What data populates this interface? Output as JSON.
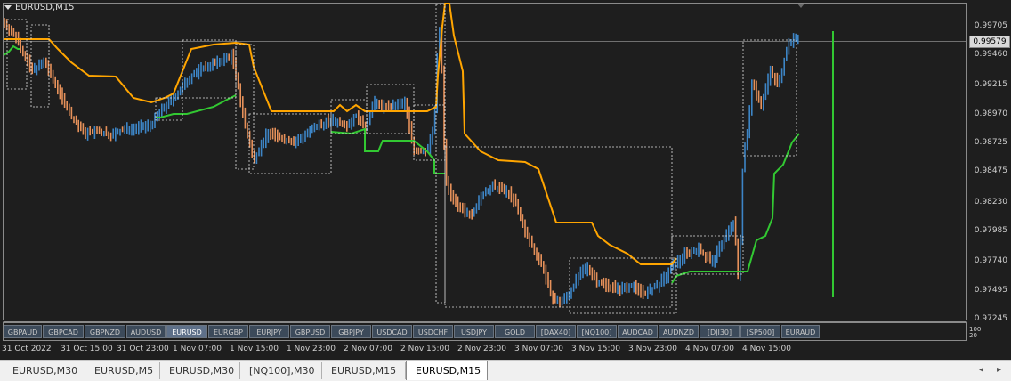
{
  "window": {
    "title": "EURUSD,M15"
  },
  "price_axis": {
    "labels": [
      "0.99705",
      "0.99460",
      "0.99215",
      "0.98970",
      "0.98725",
      "0.98475",
      "0.98230",
      "0.97985",
      "0.97740",
      "0.97495",
      "0.97245"
    ],
    "current": "0.99579"
  },
  "symbol_buttons": [
    "GBPAUD",
    "GBPCAD",
    "GBPNZD",
    "AUDUSD",
    "EURUSD",
    "EURGBP",
    "EURJPY",
    "GBPUSD",
    "GBPJPY",
    "USDCAD",
    "USDCHF",
    "USDJPY",
    "GOLD",
    "[DAX40]",
    "[NQ100]",
    "AUDCAD",
    "AUDNZD",
    "[DJI30]",
    "[SP500]",
    "EURAUD"
  ],
  "active_symbol": "EURUSD",
  "indicator_scale": {
    "top": "100",
    "bottom": "20"
  },
  "time_axis": [
    "31 Oct 2022",
    "31 Oct 15:00",
    "31 Oct 23:00",
    "1 Nov 07:00",
    "1 Nov 15:00",
    "1 Nov 23:00",
    "2 Nov 07:00",
    "2 Nov 15:00",
    "2 Nov 23:00",
    "3 Nov 07:00",
    "3 Nov 15:00",
    "3 Nov 23:00",
    "4 Nov 07:00",
    "4 Nov 15:00"
  ],
  "tabs": [
    "EURUSD,M30",
    "EURUSD,M5",
    "EURUSD,M30",
    "[NQ100],M30",
    "EURUSD,M15",
    "EURUSD,M15"
  ],
  "active_tab_index": 5,
  "colors": {
    "background": "#1e1e1e",
    "bull": "#3d85c6",
    "bear": "#e6915a",
    "upper_band": "#ffa500",
    "lower_band": "#32c832",
    "dashed_box": "#e0e0e0",
    "grid_line": "#707070"
  },
  "icons": {
    "title_menu": "triangle-down-icon",
    "scroll_left": "arrow-left-icon",
    "scroll_right": "arrow-right-icon"
  }
}
